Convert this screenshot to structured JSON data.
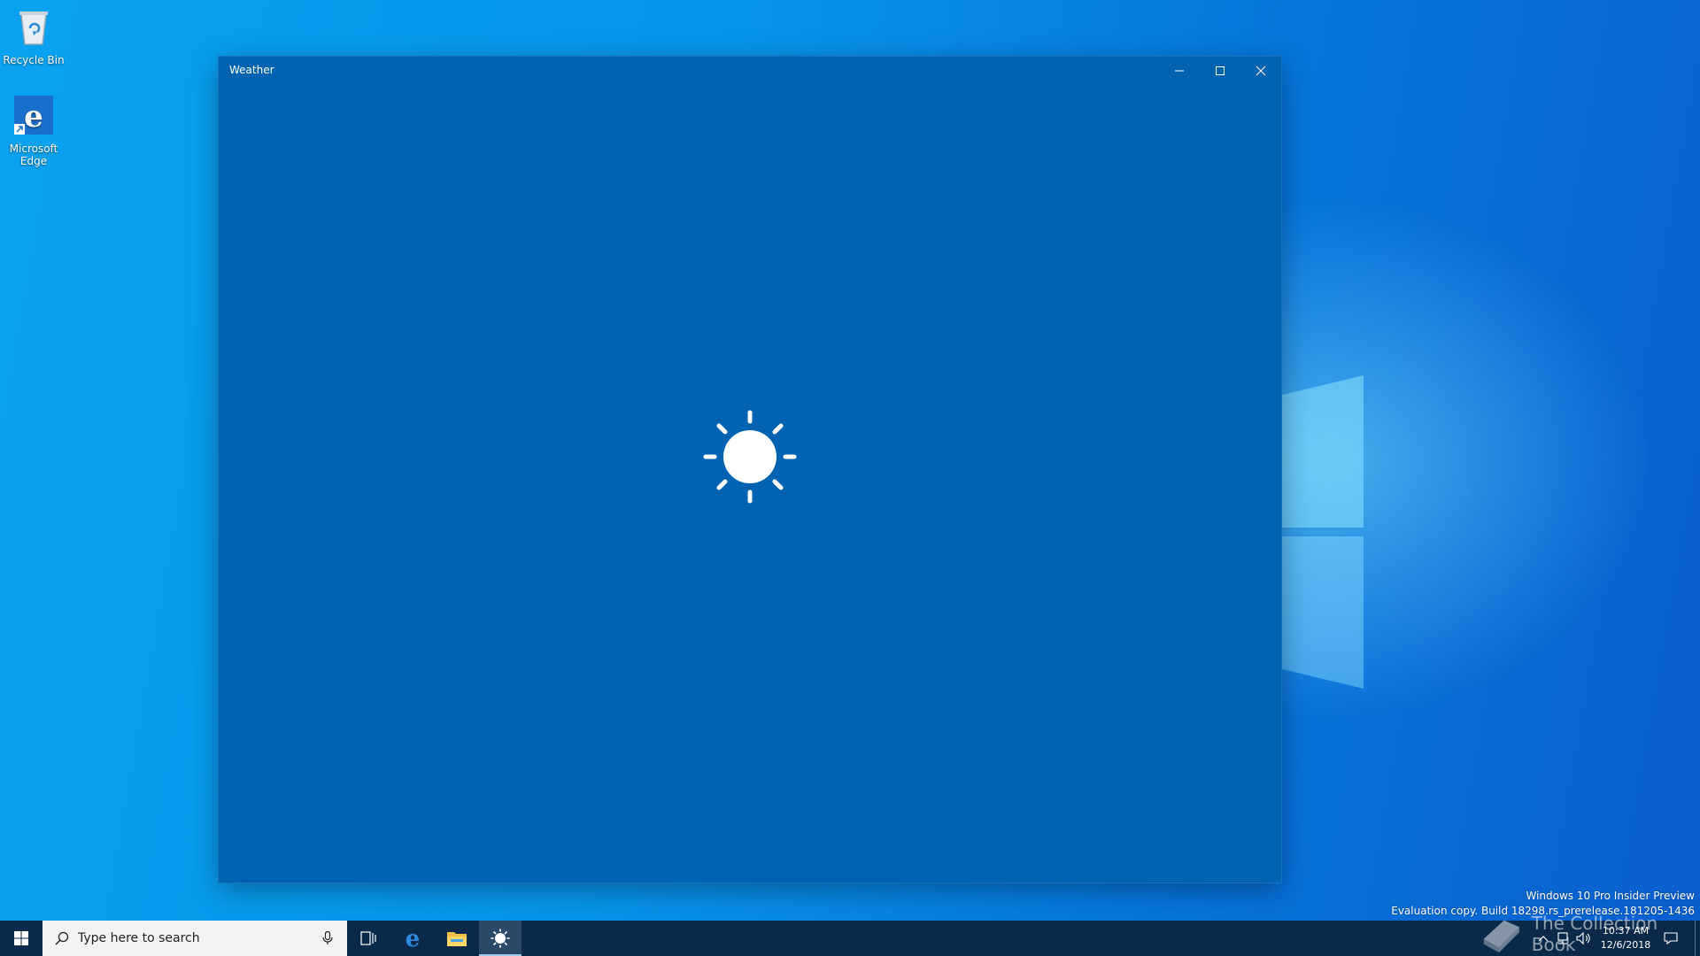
{
  "desktop": {
    "icons": [
      {
        "label": "Recycle Bin",
        "icon": "recycle-bin-icon"
      },
      {
        "label": "Microsoft Edge",
        "icon": "edge-icon"
      }
    ],
    "watermark": {
      "line1": "Windows 10 Pro Insider Preview",
      "line2": "Evaluation copy. Build 18298.rs_prerelease.181205-1436"
    }
  },
  "window": {
    "title": "Weather",
    "accent": "#0063b1",
    "controls": {
      "minimize": "minimize-icon",
      "maximize": "maximize-icon",
      "close": "close-icon"
    },
    "splash_icon": "sun-icon"
  },
  "taskbar": {
    "search_placeholder": "Type here to search",
    "apps": [
      "start-icon",
      "task-view-icon",
      "edge-icon",
      "file-explorer-icon",
      "weather-sun-icon"
    ],
    "active_app": "weather-sun-icon",
    "clock": {
      "time": "10:37 AM",
      "date": "12/6/2018"
    },
    "brand_text": "The Collection Book"
  }
}
